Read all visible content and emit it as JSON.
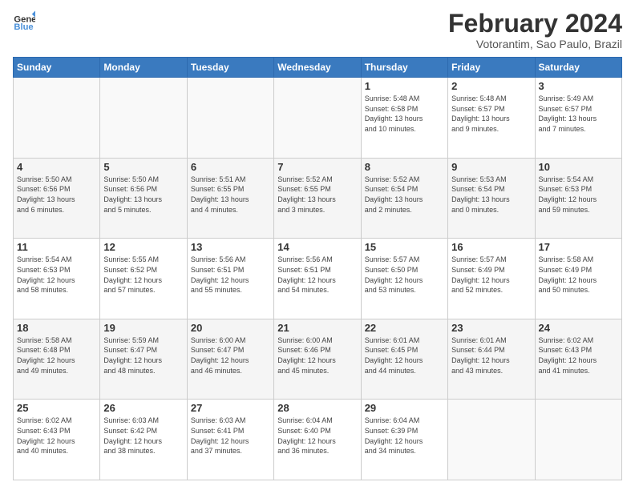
{
  "logo": {
    "line1": "General",
    "line2": "Blue"
  },
  "title": "February 2024",
  "subtitle": "Votorantim, Sao Paulo, Brazil",
  "days_header": [
    "Sunday",
    "Monday",
    "Tuesday",
    "Wednesday",
    "Thursday",
    "Friday",
    "Saturday"
  ],
  "weeks": [
    [
      {
        "day": "",
        "info": ""
      },
      {
        "day": "",
        "info": ""
      },
      {
        "day": "",
        "info": ""
      },
      {
        "day": "",
        "info": ""
      },
      {
        "day": "1",
        "info": "Sunrise: 5:48 AM\nSunset: 6:58 PM\nDaylight: 13 hours\nand 10 minutes."
      },
      {
        "day": "2",
        "info": "Sunrise: 5:48 AM\nSunset: 6:57 PM\nDaylight: 13 hours\nand 9 minutes."
      },
      {
        "day": "3",
        "info": "Sunrise: 5:49 AM\nSunset: 6:57 PM\nDaylight: 13 hours\nand 7 minutes."
      }
    ],
    [
      {
        "day": "4",
        "info": "Sunrise: 5:50 AM\nSunset: 6:56 PM\nDaylight: 13 hours\nand 6 minutes."
      },
      {
        "day": "5",
        "info": "Sunrise: 5:50 AM\nSunset: 6:56 PM\nDaylight: 13 hours\nand 5 minutes."
      },
      {
        "day": "6",
        "info": "Sunrise: 5:51 AM\nSunset: 6:55 PM\nDaylight: 13 hours\nand 4 minutes."
      },
      {
        "day": "7",
        "info": "Sunrise: 5:52 AM\nSunset: 6:55 PM\nDaylight: 13 hours\nand 3 minutes."
      },
      {
        "day": "8",
        "info": "Sunrise: 5:52 AM\nSunset: 6:54 PM\nDaylight: 13 hours\nand 2 minutes."
      },
      {
        "day": "9",
        "info": "Sunrise: 5:53 AM\nSunset: 6:54 PM\nDaylight: 13 hours\nand 0 minutes."
      },
      {
        "day": "10",
        "info": "Sunrise: 5:54 AM\nSunset: 6:53 PM\nDaylight: 12 hours\nand 59 minutes."
      }
    ],
    [
      {
        "day": "11",
        "info": "Sunrise: 5:54 AM\nSunset: 6:53 PM\nDaylight: 12 hours\nand 58 minutes."
      },
      {
        "day": "12",
        "info": "Sunrise: 5:55 AM\nSunset: 6:52 PM\nDaylight: 12 hours\nand 57 minutes."
      },
      {
        "day": "13",
        "info": "Sunrise: 5:56 AM\nSunset: 6:51 PM\nDaylight: 12 hours\nand 55 minutes."
      },
      {
        "day": "14",
        "info": "Sunrise: 5:56 AM\nSunset: 6:51 PM\nDaylight: 12 hours\nand 54 minutes."
      },
      {
        "day": "15",
        "info": "Sunrise: 5:57 AM\nSunset: 6:50 PM\nDaylight: 12 hours\nand 53 minutes."
      },
      {
        "day": "16",
        "info": "Sunrise: 5:57 AM\nSunset: 6:49 PM\nDaylight: 12 hours\nand 52 minutes."
      },
      {
        "day": "17",
        "info": "Sunrise: 5:58 AM\nSunset: 6:49 PM\nDaylight: 12 hours\nand 50 minutes."
      }
    ],
    [
      {
        "day": "18",
        "info": "Sunrise: 5:58 AM\nSunset: 6:48 PM\nDaylight: 12 hours\nand 49 minutes."
      },
      {
        "day": "19",
        "info": "Sunrise: 5:59 AM\nSunset: 6:47 PM\nDaylight: 12 hours\nand 48 minutes."
      },
      {
        "day": "20",
        "info": "Sunrise: 6:00 AM\nSunset: 6:47 PM\nDaylight: 12 hours\nand 46 minutes."
      },
      {
        "day": "21",
        "info": "Sunrise: 6:00 AM\nSunset: 6:46 PM\nDaylight: 12 hours\nand 45 minutes."
      },
      {
        "day": "22",
        "info": "Sunrise: 6:01 AM\nSunset: 6:45 PM\nDaylight: 12 hours\nand 44 minutes."
      },
      {
        "day": "23",
        "info": "Sunrise: 6:01 AM\nSunset: 6:44 PM\nDaylight: 12 hours\nand 43 minutes."
      },
      {
        "day": "24",
        "info": "Sunrise: 6:02 AM\nSunset: 6:43 PM\nDaylight: 12 hours\nand 41 minutes."
      }
    ],
    [
      {
        "day": "25",
        "info": "Sunrise: 6:02 AM\nSunset: 6:43 PM\nDaylight: 12 hours\nand 40 minutes."
      },
      {
        "day": "26",
        "info": "Sunrise: 6:03 AM\nSunset: 6:42 PM\nDaylight: 12 hours\nand 38 minutes."
      },
      {
        "day": "27",
        "info": "Sunrise: 6:03 AM\nSunset: 6:41 PM\nDaylight: 12 hours\nand 37 minutes."
      },
      {
        "day": "28",
        "info": "Sunrise: 6:04 AM\nSunset: 6:40 PM\nDaylight: 12 hours\nand 36 minutes."
      },
      {
        "day": "29",
        "info": "Sunrise: 6:04 AM\nSunset: 6:39 PM\nDaylight: 12 hours\nand 34 minutes."
      },
      {
        "day": "",
        "info": ""
      },
      {
        "day": "",
        "info": ""
      }
    ]
  ]
}
